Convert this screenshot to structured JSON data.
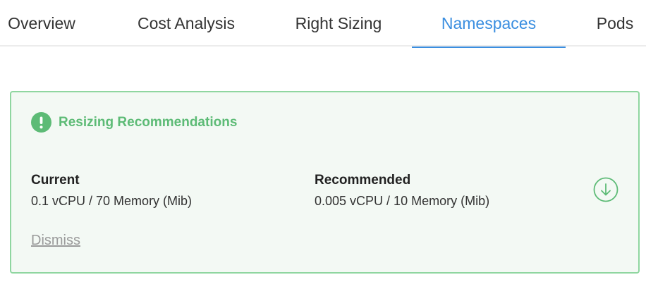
{
  "tabs": [
    {
      "label": "Overview"
    },
    {
      "label": "Cost Analysis"
    },
    {
      "label": "Right Sizing"
    },
    {
      "label": "Namespaces",
      "active": true
    },
    {
      "label": "Pods"
    }
  ],
  "card": {
    "icon": "exclamation-circle-icon",
    "title": "Resizing Recommendations",
    "current": {
      "label": "Current",
      "value": "0.1 vCPU / 70 Memory (Mib)"
    },
    "recommended": {
      "label": "Recommended",
      "value": "0.005 vCPU / 10 Memory (Mib)"
    },
    "action_icon": "arrow-down-circle-icon",
    "dismiss_label": "Dismiss"
  },
  "colors": {
    "accent": "#3a8ee0",
    "success": "#5dbb76",
    "card_border": "#8fd6a0",
    "card_bg": "#f3f9f4"
  }
}
